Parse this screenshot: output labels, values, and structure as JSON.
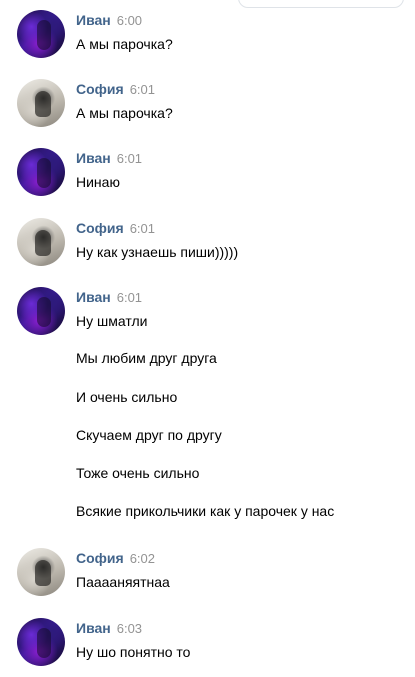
{
  "messages": [
    {
      "author": "Иван",
      "time": "6:00",
      "avatar": "ivan",
      "lines": [
        "А мы парочка?"
      ]
    },
    {
      "author": "София",
      "time": "6:01",
      "avatar": "sofia",
      "lines": [
        "А мы парочка?"
      ]
    },
    {
      "author": "Иван",
      "time": "6:01",
      "avatar": "ivan",
      "lines": [
        "Нинаю"
      ]
    },
    {
      "author": "София",
      "time": "6:01",
      "avatar": "sofia",
      "lines": [
        "Ну как узнаешь пиши)))))"
      ]
    },
    {
      "author": "Иван",
      "time": "6:01",
      "avatar": "ivan",
      "lines": [
        "Ну шматли",
        "Мы любим друг друга",
        "И очень сильно",
        "Скучаем друг по другу",
        "Тоже очень сильно",
        "Всякие прикольчики как у парочек у нас"
      ]
    },
    {
      "author": "София",
      "time": "6:02",
      "avatar": "sofia",
      "lines": [
        "Пааааняятнаа"
      ]
    },
    {
      "author": "Иван",
      "time": "6:03",
      "avatar": "ivan",
      "lines": [
        "Ну шо понятно то"
      ]
    }
  ]
}
